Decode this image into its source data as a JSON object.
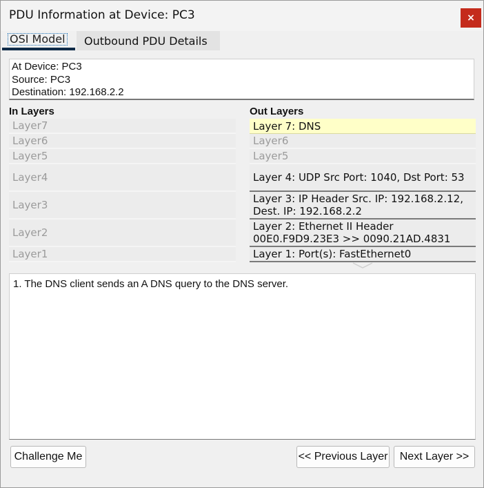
{
  "window": {
    "title": "PDU Information at Device: PC3",
    "close_label": "×"
  },
  "tabs": [
    {
      "label": "OSI Model"
    },
    {
      "label": "Outbound PDU Details"
    }
  ],
  "info": {
    "device": "At Device: PC3",
    "source": "Source: PC3",
    "destination": "Destination: 192.168.2.2"
  },
  "in_layers": {
    "title": "In Layers",
    "items": [
      "Layer7",
      "Layer6",
      "Layer5",
      "Layer4",
      "Layer3",
      "Layer2",
      "Layer1"
    ]
  },
  "out_layers": {
    "title": "Out Layers",
    "items": [
      "Layer 7: DNS",
      "Layer6",
      "Layer5",
      "Layer 4: UDP Src Port: 1040, Dst Port: 53",
      "Layer 3: IP Header Src. IP: 192.168.2.12, Dest. IP: 192.168.2.2",
      "Layer 2: Ethernet II Header 00E0.F9D9.23E3 >> 0090.21AD.4831",
      "Layer 1: Port(s): FastEthernet0"
    ]
  },
  "description": "1. The DNS client sends an A DNS query to the DNS server.",
  "buttons": {
    "challenge": "Challenge Me",
    "previous": "<< Previous Layer",
    "next": "Next Layer >>"
  },
  "colors": {
    "close_bg": "#c42b1c",
    "highlight": "#ffffc8",
    "tab_underline": "#0e2a47"
  }
}
